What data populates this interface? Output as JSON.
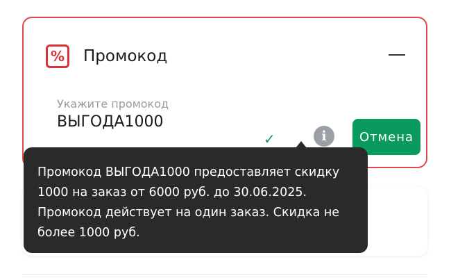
{
  "promo": {
    "title": "Промокод",
    "icon": "percent-icon",
    "icon_glyph": "%",
    "input_placeholder": "Укажите промокод",
    "input_value": "ВЫГОДА1000",
    "check_glyph": "✓",
    "info_glyph": "i",
    "cancel_label": "Отмена"
  },
  "tooltip": {
    "text": "Промокод ВЫГОДА1000 предоставляет скидку 1000 на заказ от 6000 руб. до 30.06.2025. Промокод действует на один заказ. Скидка не более 1000 руб."
  },
  "colors": {
    "accent_green": "#0a9a60",
    "border_red": "#e0484b",
    "tooltip_bg": "#2a2a2a",
    "info_grey": "#9aa0a6"
  }
}
